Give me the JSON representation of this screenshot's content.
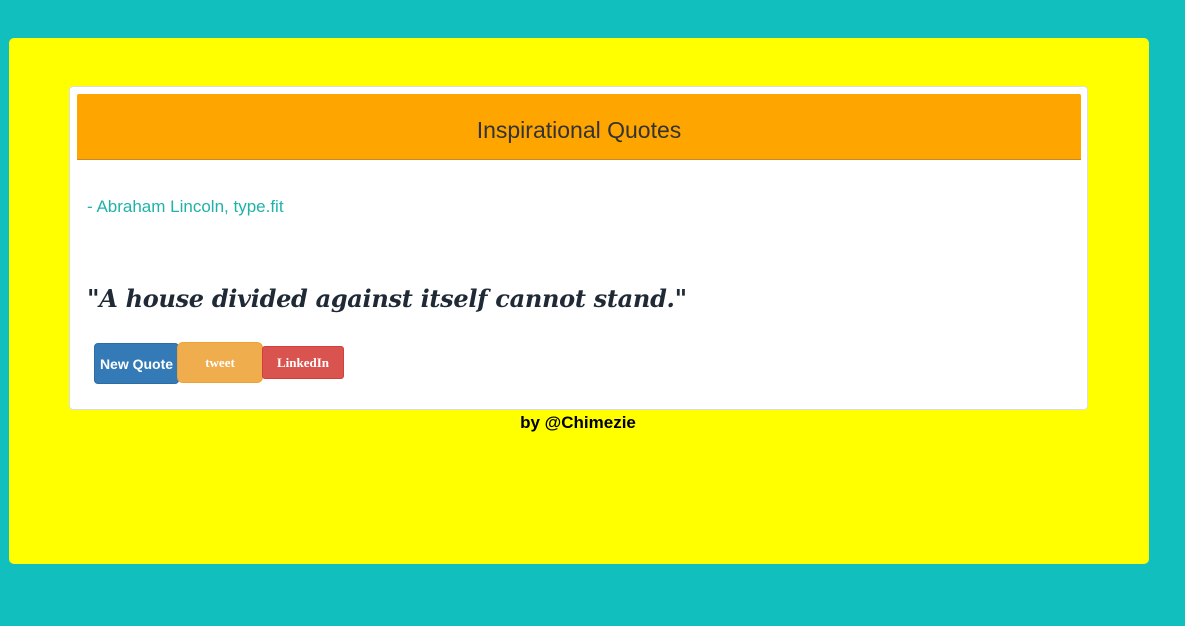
{
  "header": {
    "title": "Inspirational Quotes"
  },
  "quote": {
    "author": "- Abraham Lincoln, type.fit",
    "text": "\"A house divided against itself cannot stand.\""
  },
  "buttons": {
    "new_quote": "New Quote",
    "tweet": "tweet",
    "linkedin": "LinkedIn"
  },
  "footer": {
    "byline": "by @Chimezie"
  },
  "colors": {
    "page_background": "#12bfbf",
    "panel_background": "#ffff00",
    "header_background": "#ffa500",
    "author_text": "#20b2aa",
    "new_quote_button": "#337ab7",
    "tweet_button": "#f0ad4e",
    "linkedin_button": "#d9534f"
  }
}
